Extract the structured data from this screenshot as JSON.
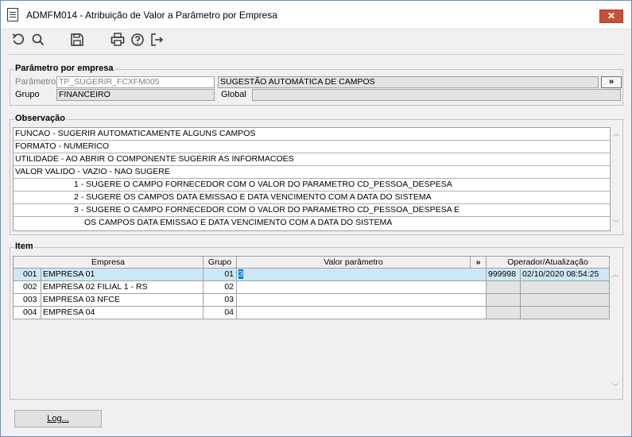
{
  "window": {
    "title": "ADMFM014 - Atribuição de Valor a Parâmetro por Empresa",
    "close_label": "✕"
  },
  "toolbar": {
    "buttons": [
      {
        "name": "undo-icon"
      },
      {
        "name": "search-icon"
      },
      {
        "name": "save-icon"
      },
      {
        "name": "print-icon"
      },
      {
        "name": "help-icon"
      },
      {
        "name": "exit-icon"
      }
    ]
  },
  "param": {
    "group_title": "Parâmetro por empresa",
    "parametro_label": "Parâmetro",
    "parametro_value": "TP_SUGERIR_FCXFM005",
    "parametro_desc": "SUGESTÃO AUTOMÁTICA DE CAMPOS",
    "more_label": "»",
    "grupo_label": "Grupo",
    "grupo_value": "FINANCEIRO",
    "global_label": "Global",
    "global_value": ""
  },
  "observacao": {
    "group_title": "Observação",
    "lines": [
      "FUNCAO - SUGERIR AUTOMATICAMENTE ALGUNS CAMPOS",
      "FORMATO - NUMERICO",
      "UTILIDADE - AO ABRIR O COMPONENTE SUGERIR AS INFORMACOES",
      "VALOR VALIDO - VAZIO - NAO SUGERE",
      "1 - SUGERE O CAMPO FORNECEDOR COM O VALOR DO PARAMETRO CD_PESSOA_DESPESA",
      "2 - SUGERE OS CAMPOS DATA EMISSAO E DATA VENCIMENTO COM A DATA DO SISTEMA",
      "3 - SUGERE O CAMPO FORNECEDOR COM O VALOR DO PARAMETRO CD_PESSOA_DESPESA E",
      "OS CAMPOS DATA EMISSAO E DATA VENCIMENTO COM A DATA DO SISTEMA"
    ]
  },
  "item": {
    "group_title": "Item",
    "headers": {
      "empresa": "Empresa",
      "grupo": "Grupo",
      "valor": "Valor parâmetro",
      "more": "»",
      "operador": "Operador/Atualização"
    },
    "rows": [
      {
        "code": "001",
        "empresa": "EMPRESA 01",
        "grupo": "01",
        "valor": "3",
        "operador": "999998",
        "atualizacao": "02/10/2020 08:54:25"
      },
      {
        "code": "002",
        "empresa": "EMPRESA 02 FILIAL 1 - RS",
        "grupo": "02",
        "valor": "",
        "operador": "",
        "atualizacao": ""
      },
      {
        "code": "003",
        "empresa": "EMPRESA 03 NFCE",
        "grupo": "03",
        "valor": "",
        "operador": "",
        "atualizacao": ""
      },
      {
        "code": "004",
        "empresa": "EMPRESA 04",
        "grupo": "04",
        "valor": "",
        "operador": "",
        "atualizacao": ""
      }
    ]
  },
  "footer": {
    "log_label": "Log..."
  }
}
